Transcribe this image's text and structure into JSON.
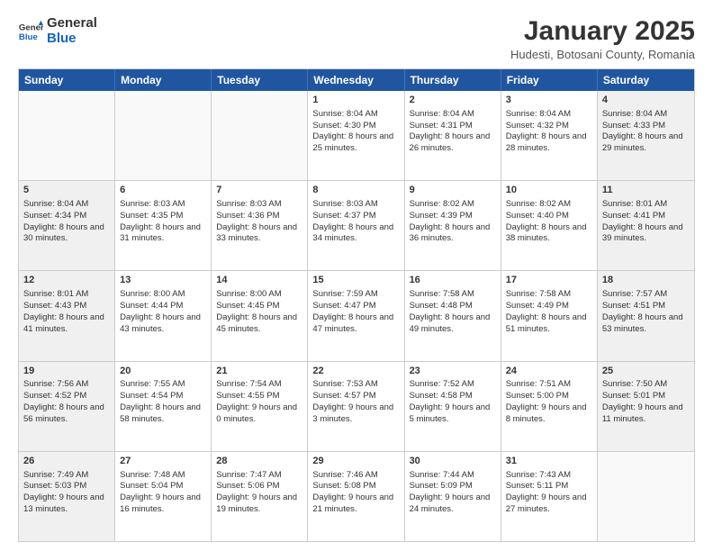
{
  "header": {
    "logo_general": "General",
    "logo_blue": "Blue",
    "title": "January 2025",
    "subtitle": "Hudesti, Botosani County, Romania"
  },
  "days_of_week": [
    "Sunday",
    "Monday",
    "Tuesday",
    "Wednesday",
    "Thursday",
    "Friday",
    "Saturday"
  ],
  "weeks": [
    [
      {
        "day": "",
        "text": "",
        "shaded": false,
        "empty": true
      },
      {
        "day": "",
        "text": "",
        "shaded": false,
        "empty": true
      },
      {
        "day": "",
        "text": "",
        "shaded": false,
        "empty": true
      },
      {
        "day": "1",
        "text": "Sunrise: 8:04 AM\nSunset: 4:30 PM\nDaylight: 8 hours and 25 minutes.",
        "shaded": false,
        "empty": false
      },
      {
        "day": "2",
        "text": "Sunrise: 8:04 AM\nSunset: 4:31 PM\nDaylight: 8 hours and 26 minutes.",
        "shaded": false,
        "empty": false
      },
      {
        "day": "3",
        "text": "Sunrise: 8:04 AM\nSunset: 4:32 PM\nDaylight: 8 hours and 28 minutes.",
        "shaded": false,
        "empty": false
      },
      {
        "day": "4",
        "text": "Sunrise: 8:04 AM\nSunset: 4:33 PM\nDaylight: 8 hours and 29 minutes.",
        "shaded": true,
        "empty": false
      }
    ],
    [
      {
        "day": "5",
        "text": "Sunrise: 8:04 AM\nSunset: 4:34 PM\nDaylight: 8 hours and 30 minutes.",
        "shaded": true,
        "empty": false
      },
      {
        "day": "6",
        "text": "Sunrise: 8:03 AM\nSunset: 4:35 PM\nDaylight: 8 hours and 31 minutes.",
        "shaded": false,
        "empty": false
      },
      {
        "day": "7",
        "text": "Sunrise: 8:03 AM\nSunset: 4:36 PM\nDaylight: 8 hours and 33 minutes.",
        "shaded": false,
        "empty": false
      },
      {
        "day": "8",
        "text": "Sunrise: 8:03 AM\nSunset: 4:37 PM\nDaylight: 8 hours and 34 minutes.",
        "shaded": false,
        "empty": false
      },
      {
        "day": "9",
        "text": "Sunrise: 8:02 AM\nSunset: 4:39 PM\nDaylight: 8 hours and 36 minutes.",
        "shaded": false,
        "empty": false
      },
      {
        "day": "10",
        "text": "Sunrise: 8:02 AM\nSunset: 4:40 PM\nDaylight: 8 hours and 38 minutes.",
        "shaded": false,
        "empty": false
      },
      {
        "day": "11",
        "text": "Sunrise: 8:01 AM\nSunset: 4:41 PM\nDaylight: 8 hours and 39 minutes.",
        "shaded": true,
        "empty": false
      }
    ],
    [
      {
        "day": "12",
        "text": "Sunrise: 8:01 AM\nSunset: 4:43 PM\nDaylight: 8 hours and 41 minutes.",
        "shaded": true,
        "empty": false
      },
      {
        "day": "13",
        "text": "Sunrise: 8:00 AM\nSunset: 4:44 PM\nDaylight: 8 hours and 43 minutes.",
        "shaded": false,
        "empty": false
      },
      {
        "day": "14",
        "text": "Sunrise: 8:00 AM\nSunset: 4:45 PM\nDaylight: 8 hours and 45 minutes.",
        "shaded": false,
        "empty": false
      },
      {
        "day": "15",
        "text": "Sunrise: 7:59 AM\nSunset: 4:47 PM\nDaylight: 8 hours and 47 minutes.",
        "shaded": false,
        "empty": false
      },
      {
        "day": "16",
        "text": "Sunrise: 7:58 AM\nSunset: 4:48 PM\nDaylight: 8 hours and 49 minutes.",
        "shaded": false,
        "empty": false
      },
      {
        "day": "17",
        "text": "Sunrise: 7:58 AM\nSunset: 4:49 PM\nDaylight: 8 hours and 51 minutes.",
        "shaded": false,
        "empty": false
      },
      {
        "day": "18",
        "text": "Sunrise: 7:57 AM\nSunset: 4:51 PM\nDaylight: 8 hours and 53 minutes.",
        "shaded": true,
        "empty": false
      }
    ],
    [
      {
        "day": "19",
        "text": "Sunrise: 7:56 AM\nSunset: 4:52 PM\nDaylight: 8 hours and 56 minutes.",
        "shaded": true,
        "empty": false
      },
      {
        "day": "20",
        "text": "Sunrise: 7:55 AM\nSunset: 4:54 PM\nDaylight: 8 hours and 58 minutes.",
        "shaded": false,
        "empty": false
      },
      {
        "day": "21",
        "text": "Sunrise: 7:54 AM\nSunset: 4:55 PM\nDaylight: 9 hours and 0 minutes.",
        "shaded": false,
        "empty": false
      },
      {
        "day": "22",
        "text": "Sunrise: 7:53 AM\nSunset: 4:57 PM\nDaylight: 9 hours and 3 minutes.",
        "shaded": false,
        "empty": false
      },
      {
        "day": "23",
        "text": "Sunrise: 7:52 AM\nSunset: 4:58 PM\nDaylight: 9 hours and 5 minutes.",
        "shaded": false,
        "empty": false
      },
      {
        "day": "24",
        "text": "Sunrise: 7:51 AM\nSunset: 5:00 PM\nDaylight: 9 hours and 8 minutes.",
        "shaded": false,
        "empty": false
      },
      {
        "day": "25",
        "text": "Sunrise: 7:50 AM\nSunset: 5:01 PM\nDaylight: 9 hours and 11 minutes.",
        "shaded": true,
        "empty": false
      }
    ],
    [
      {
        "day": "26",
        "text": "Sunrise: 7:49 AM\nSunset: 5:03 PM\nDaylight: 9 hours and 13 minutes.",
        "shaded": true,
        "empty": false
      },
      {
        "day": "27",
        "text": "Sunrise: 7:48 AM\nSunset: 5:04 PM\nDaylight: 9 hours and 16 minutes.",
        "shaded": false,
        "empty": false
      },
      {
        "day": "28",
        "text": "Sunrise: 7:47 AM\nSunset: 5:06 PM\nDaylight: 9 hours and 19 minutes.",
        "shaded": false,
        "empty": false
      },
      {
        "day": "29",
        "text": "Sunrise: 7:46 AM\nSunset: 5:08 PM\nDaylight: 9 hours and 21 minutes.",
        "shaded": false,
        "empty": false
      },
      {
        "day": "30",
        "text": "Sunrise: 7:44 AM\nSunset: 5:09 PM\nDaylight: 9 hours and 24 minutes.",
        "shaded": false,
        "empty": false
      },
      {
        "day": "31",
        "text": "Sunrise: 7:43 AM\nSunset: 5:11 PM\nDaylight: 9 hours and 27 minutes.",
        "shaded": false,
        "empty": false
      },
      {
        "day": "",
        "text": "",
        "shaded": true,
        "empty": true
      }
    ]
  ]
}
